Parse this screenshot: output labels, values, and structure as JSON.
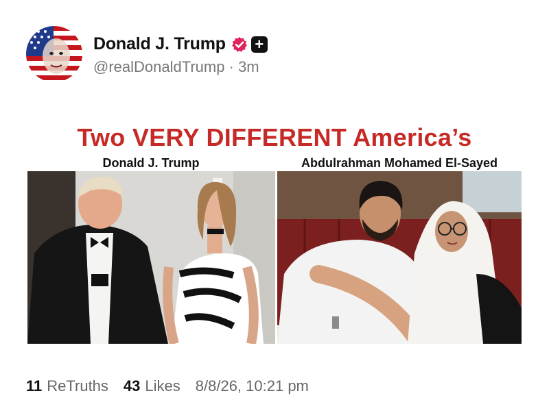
{
  "post": {
    "display_name": "Donald J. Trump",
    "handle": "@realDonaldTrump",
    "separator": "·",
    "time_ago": "3m",
    "avatar_icon": "flag-face-avatar",
    "verified_icon": "verified-badge-icon",
    "verified_color": "#e0245e",
    "plus_icon": "plus-icon",
    "plus_label": "+"
  },
  "image": {
    "headline": "Two VERY DIFFERENT America’s",
    "headline_color": "#c62a27",
    "left_caption": "Donald J. Trump",
    "right_caption": "Abdulrahman Mohamed El-Sayed"
  },
  "stats": {
    "retruths_count": "11",
    "retruths_label": "ReTruths",
    "likes_count": "43",
    "likes_label": "Likes",
    "timestamp": "8/8/26, 10:21 pm"
  }
}
